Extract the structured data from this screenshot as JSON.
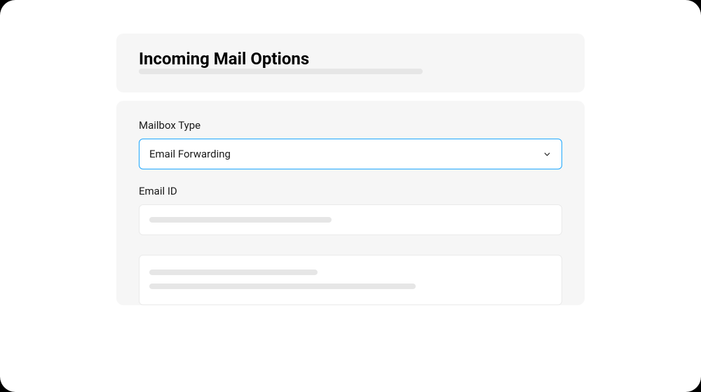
{
  "header": {
    "title": "Incoming Mail Options"
  },
  "form": {
    "mailbox_type": {
      "label": "Mailbox Type",
      "selected": "Email Forwarding"
    },
    "email_id": {
      "label": "Email ID",
      "value": ""
    }
  },
  "icons": {
    "chevron_down": "chevron-down-icon"
  },
  "colors": {
    "panel_bg": "#f6f6f6",
    "focus_border": "#1ea7fd",
    "skeleton": "#e6e6e6"
  }
}
